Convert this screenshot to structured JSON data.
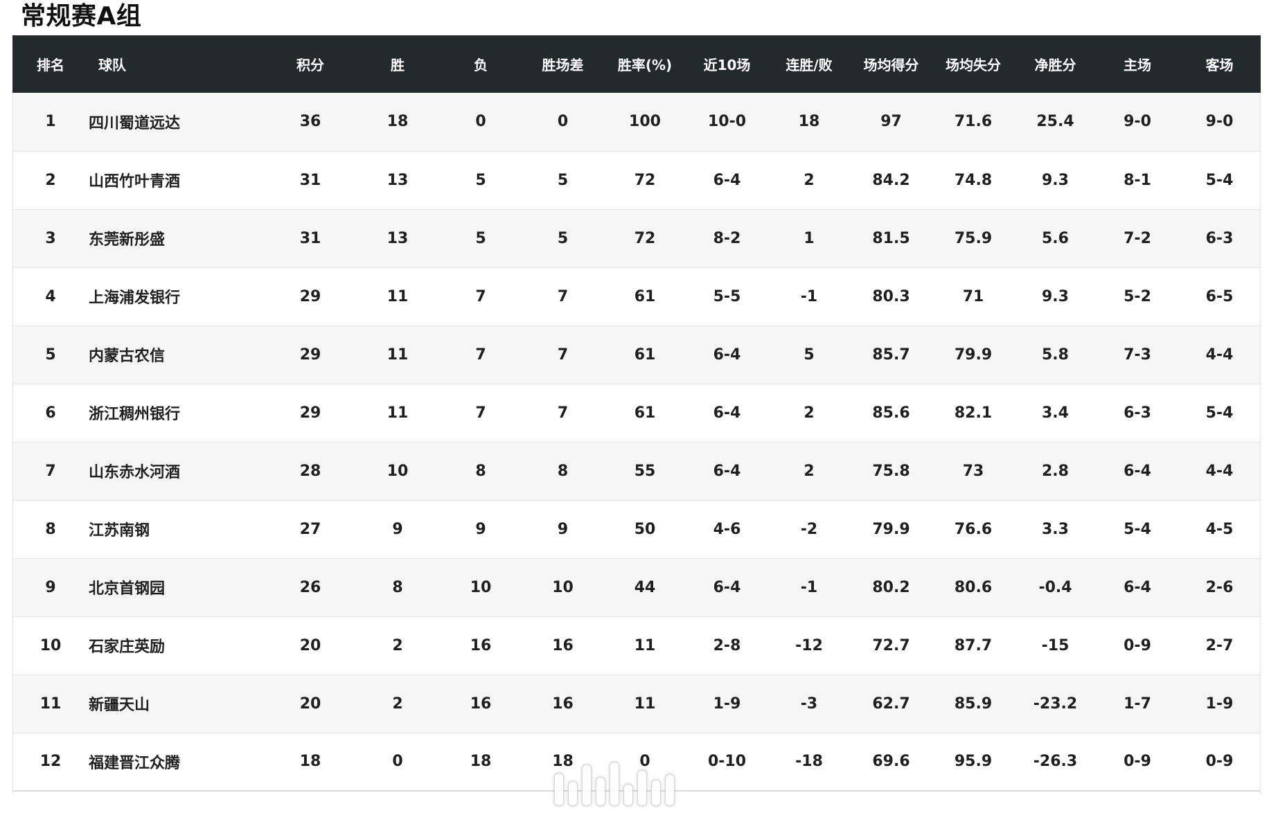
{
  "page": {
    "title": "常规赛A组"
  },
  "table": {
    "headers": {
      "rank": "排名",
      "team": "球队",
      "points": "积分",
      "wins": "胜",
      "losses": "负",
      "win_diff": "胜场差",
      "win_pct": "胜率(%)",
      "last10": "近10场",
      "streak": "连胜/败",
      "ppg": "场均得分",
      "oppg": "场均失分",
      "net": "净胜分",
      "home": "主场",
      "away": "客场"
    },
    "rows": [
      {
        "rank": "1",
        "team": "四川蜀道远达",
        "points": "36",
        "wins": "18",
        "losses": "0",
        "win_diff": "0",
        "win_pct": "100",
        "last10": "10-0",
        "streak": "18",
        "ppg": "97",
        "oppg": "71.6",
        "net": "25.4",
        "home": "9-0",
        "away": "9-0"
      },
      {
        "rank": "2",
        "team": "山西竹叶青酒",
        "points": "31",
        "wins": "13",
        "losses": "5",
        "win_diff": "5",
        "win_pct": "72",
        "last10": "6-4",
        "streak": "2",
        "ppg": "84.2",
        "oppg": "74.8",
        "net": "9.3",
        "home": "8-1",
        "away": "5-4"
      },
      {
        "rank": "3",
        "team": "东莞新彤盛",
        "points": "31",
        "wins": "13",
        "losses": "5",
        "win_diff": "5",
        "win_pct": "72",
        "last10": "8-2",
        "streak": "1",
        "ppg": "81.5",
        "oppg": "75.9",
        "net": "5.6",
        "home": "7-2",
        "away": "6-3"
      },
      {
        "rank": "4",
        "team": "上海浦发银行",
        "points": "29",
        "wins": "11",
        "losses": "7",
        "win_diff": "7",
        "win_pct": "61",
        "last10": "5-5",
        "streak": "-1",
        "ppg": "80.3",
        "oppg": "71",
        "net": "9.3",
        "home": "5-2",
        "away": "6-5"
      },
      {
        "rank": "5",
        "team": "内蒙古农信",
        "points": "29",
        "wins": "11",
        "losses": "7",
        "win_diff": "7",
        "win_pct": "61",
        "last10": "6-4",
        "streak": "5",
        "ppg": "85.7",
        "oppg": "79.9",
        "net": "5.8",
        "home": "7-3",
        "away": "4-4"
      },
      {
        "rank": "6",
        "team": "浙江稠州银行",
        "points": "29",
        "wins": "11",
        "losses": "7",
        "win_diff": "7",
        "win_pct": "61",
        "last10": "6-4",
        "streak": "2",
        "ppg": "85.6",
        "oppg": "82.1",
        "net": "3.4",
        "home": "6-3",
        "away": "5-4"
      },
      {
        "rank": "7",
        "team": "山东赤水河酒",
        "points": "28",
        "wins": "10",
        "losses": "8",
        "win_diff": "8",
        "win_pct": "55",
        "last10": "6-4",
        "streak": "2",
        "ppg": "75.8",
        "oppg": "73",
        "net": "2.8",
        "home": "6-4",
        "away": "4-4"
      },
      {
        "rank": "8",
        "team": "江苏南钢",
        "points": "27",
        "wins": "9",
        "losses": "9",
        "win_diff": "9",
        "win_pct": "50",
        "last10": "4-6",
        "streak": "-2",
        "ppg": "79.9",
        "oppg": "76.6",
        "net": "3.3",
        "home": "5-4",
        "away": "4-5"
      },
      {
        "rank": "9",
        "team": "北京首钢园",
        "points": "26",
        "wins": "8",
        "losses": "10",
        "win_diff": "10",
        "win_pct": "44",
        "last10": "6-4",
        "streak": "-1",
        "ppg": "80.2",
        "oppg": "80.6",
        "net": "-0.4",
        "home": "6-4",
        "away": "2-6"
      },
      {
        "rank": "10",
        "team": "石家庄英励",
        "points": "20",
        "wins": "2",
        "losses": "16",
        "win_diff": "16",
        "win_pct": "11",
        "last10": "2-8",
        "streak": "-12",
        "ppg": "72.7",
        "oppg": "87.7",
        "net": "-15",
        "home": "0-9",
        "away": "2-7"
      },
      {
        "rank": "11",
        "team": "新疆天山",
        "points": "20",
        "wins": "2",
        "losses": "16",
        "win_diff": "16",
        "win_pct": "11",
        "last10": "1-9",
        "streak": "-3",
        "ppg": "62.7",
        "oppg": "85.9",
        "net": "-23.2",
        "home": "1-7",
        "away": "1-9"
      },
      {
        "rank": "12",
        "team": "福建晋江众腾",
        "points": "18",
        "wins": "0",
        "losses": "18",
        "win_diff": "18",
        "win_pct": "0",
        "last10": "0-10",
        "streak": "-18",
        "ppg": "69.6",
        "oppg": "95.9",
        "net": "-26.3",
        "home": "0-9",
        "away": "0-9"
      }
    ]
  }
}
